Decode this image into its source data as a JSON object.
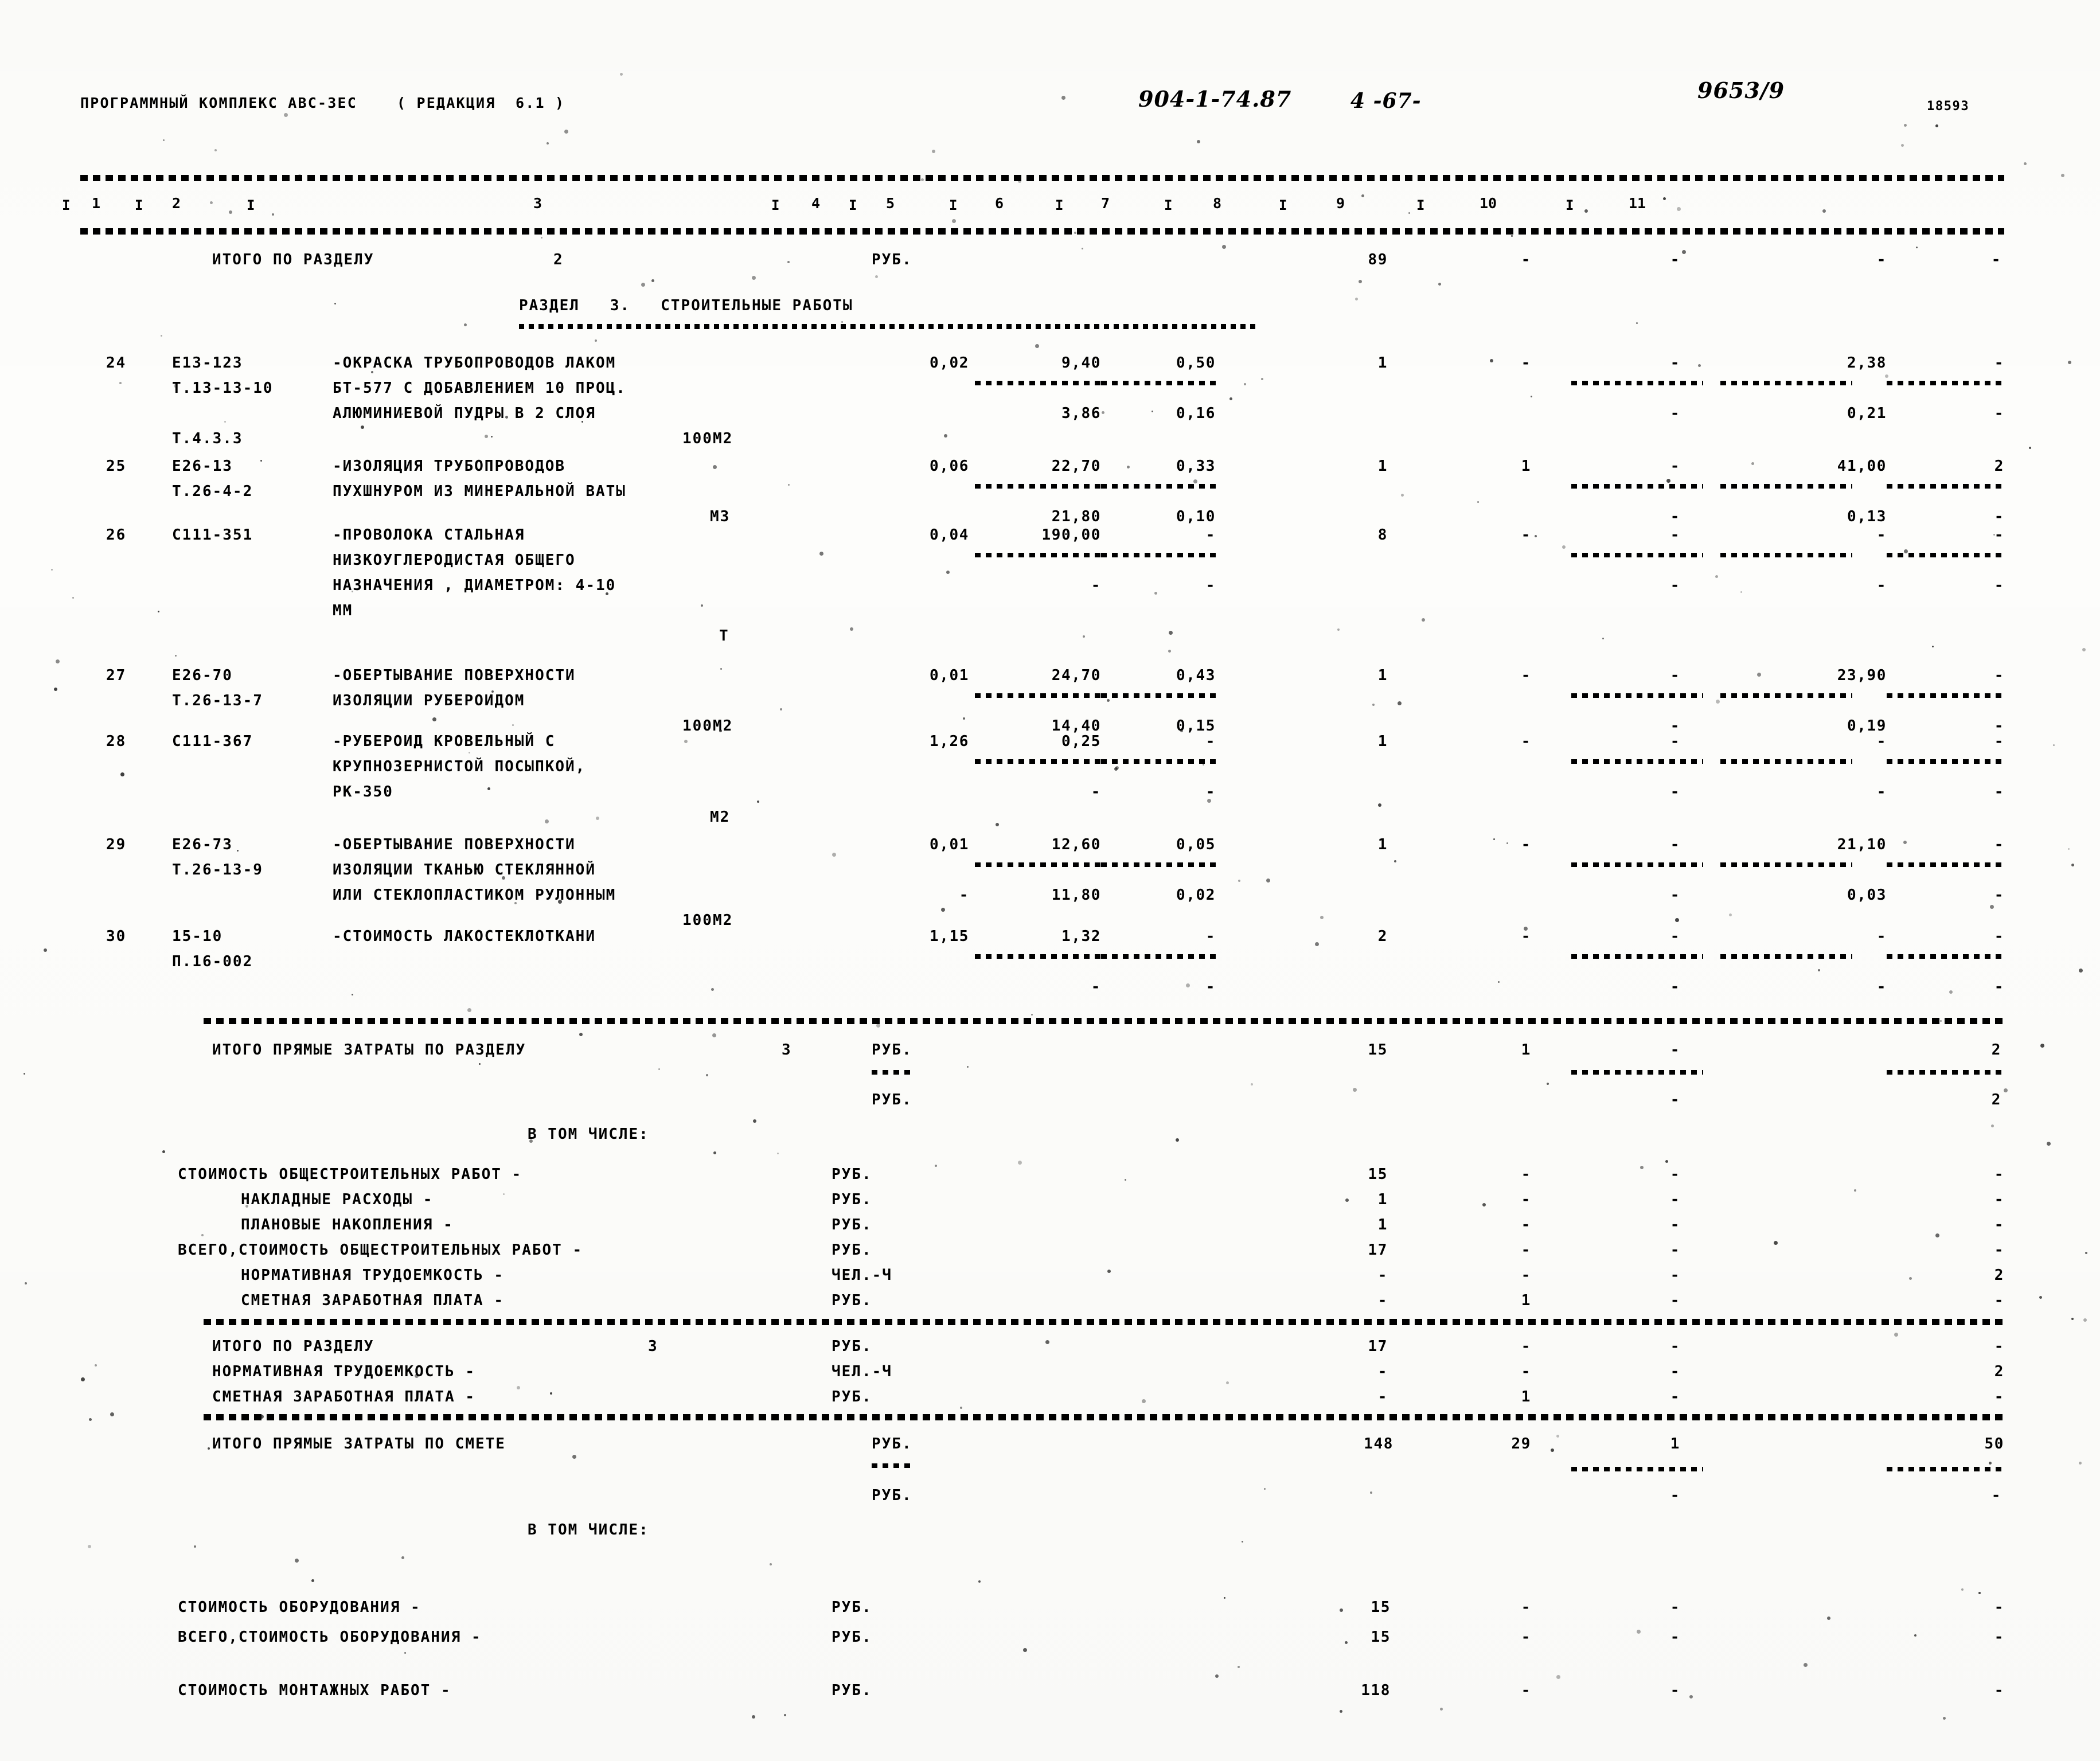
{
  "header": {
    "program_line": "ПРОГРАММНЫЙ КОМПЛЕКС АВС-ЗЕС    ( РЕДАКЦИЯ  6.1 )",
    "hand_code": "904-1-74.87",
    "hand_page": "4 -67-",
    "hand_doc": "9653/9",
    "hand_number": "18593"
  },
  "column_numbers": [
    "1",
    "2",
    "3",
    "4",
    "5",
    "6",
    "7",
    "8",
    "9",
    "10",
    "11"
  ],
  "section": {
    "prev_total_label": "ИТОГО ПО РАЗДЕЛУ",
    "prev_total_num": "2",
    "prev_total_unit": "РУБ.",
    "prev_total_c7": "89",
    "prev_total_c8": "-",
    "prev_total_c9": "-",
    "prev_total_c10": "-",
    "prev_total_c11": "-",
    "title": "РАЗДЕЛ   3.   СТРОИТЕЛЬНЫЕ РАБОТЫ"
  },
  "rows": [
    {
      "no": "24",
      "code": "Е13-123",
      "code2": "Т.13-13-10",
      "code3": "Т.4.3.3",
      "desc": [
        "-ОКРАСКА ТРУБОПРОВОДОВ ЛАКОМ",
        "БТ-577 С ДОБАВЛЕНИЕМ 10 ПРОЦ.",
        "АЛЮМИНИЕВОЙ ПУДРЫ В 2 СЛОЯ"
      ],
      "unit": "100М2",
      "c4": "0,02",
      "c5": "9,40",
      "c6": "0,50",
      "c7": "1",
      "c8": "-",
      "c9": "-",
      "c10": "2,38",
      "c11": "-",
      "sub": {
        "c5": "3,86",
        "c6": "0,16",
        "c9": "-",
        "c10": "0,21",
        "c11": "-"
      }
    },
    {
      "no": "25",
      "code": "Е26-13",
      "code2": "Т.26-4-2",
      "code3": "",
      "desc": [
        "-ИЗОЛЯЦИЯ ТРУБОПРОВОДОВ",
        "ПУХШНУРОМ ИЗ МИНЕРАЛЬНОЙ ВАТЫ"
      ],
      "unit": "М3",
      "c4": "0,06",
      "c5": "22,70",
      "c6": "0,33",
      "c7": "1",
      "c8": "1",
      "c9": "-",
      "c10": "41,00",
      "c11": "2",
      "sub": {
        "c5": "21,80",
        "c6": "0,10",
        "c9": "-",
        "c10": "0,13",
        "c11": "-"
      }
    },
    {
      "no": "26",
      "code": "С111-351",
      "code2": "",
      "code3": "",
      "desc": [
        "-ПРОВОЛОКА СТАЛЬНАЯ",
        "НИЗКОУГЛЕРОДИСТАЯ ОБЩЕГО",
        "НАЗНАЧЕНИЯ , ДИАМЕТРОМ: 4-10",
        "ММ"
      ],
      "unit": "Т",
      "c4": "0,04",
      "c5": "190,00",
      "c6": "-",
      "c7": "8",
      "c8": "-",
      "c9": "-",
      "c10": "-",
      "c11": "-",
      "sub": {
        "c5": "-",
        "c6": "-",
        "c9": "-",
        "c10": "-",
        "c11": "-"
      }
    },
    {
      "no": "27",
      "code": "Е26-70",
      "code2": "Т.26-13-7",
      "code3": "",
      "desc": [
        "-ОБЕРТЫВАНИЕ ПОВЕРХНОСТИ",
        "ИЗОЛЯЦИИ РУБЕРОИДОМ"
      ],
      "unit": "100М2",
      "c4": "0,01",
      "c5": "24,70",
      "c6": "0,43",
      "c7": "1",
      "c8": "-",
      "c9": "-",
      "c10": "23,90",
      "c11": "-",
      "sub": {
        "c5": "14,40",
        "c6": "0,15",
        "c9": "-",
        "c10": "0,19",
        "c11": "-"
      }
    },
    {
      "no": "28",
      "code": "С111-367",
      "code2": "",
      "code3": "",
      "desc": [
        "-РУБЕРОИД КРОВЕЛЬНЫЙ С",
        "КРУПНОЗЕРНИСТОЙ ПОСЫПКОЙ,",
        "РК-350"
      ],
      "unit": "М2",
      "c4": "1,26",
      "c5": "0,25",
      "c6": "-",
      "c7": "1",
      "c8": "-",
      "c9": "-",
      "c10": "-",
      "c11": "-",
      "sub": {
        "c5": "-",
        "c6": "-",
        "c9": "-",
        "c10": "-",
        "c11": "-"
      }
    },
    {
      "no": "29",
      "code": "Е26-73",
      "code2": "Т.26-13-9",
      "code3": "",
      "desc": [
        "-ОБЕРТЫВАНИЕ ПОВЕРХНОСТИ",
        "ИЗОЛЯЦИИ ТКАНЬЮ СТЕКЛЯННОЙ",
        "ИЛИ СТЕКЛОПЛАСТИКОМ РУЛОННЫМ"
      ],
      "unit": "100М2",
      "c4": "0,01",
      "c5": "12,60",
      "c6": "0,05",
      "c7": "1",
      "c8": "-",
      "c9": "-",
      "c10": "21,10",
      "c11": "-",
      "sub": {
        "c4": "-",
        "c5": "11,80",
        "c6": "0,02",
        "c9": "-",
        "c10": "0,03",
        "c11": "-"
      }
    },
    {
      "no": "30",
      "code": "15-10",
      "code2": "П.16-002",
      "code3": "",
      "desc": [
        "-СТОИМОСТЬ ЛАКОСТЕКЛОТКАНИ"
      ],
      "unit": "",
      "c4": "1,15",
      "c5": "1,32",
      "c6": "-",
      "c7": "2",
      "c8": "-",
      "c9": "-",
      "c10": "-",
      "c11": "-",
      "sub": {
        "c5": "-",
        "c6": "-",
        "c9": "-",
        "c10": "-",
        "c11": "-"
      }
    }
  ],
  "totals": {
    "direct_section_label": "ИТОГО ПРЯМЫЕ ЗАТРАТЫ ПО РАЗДЕЛУ",
    "direct_section_num": "3",
    "direct_section_unit": "РУБ.",
    "direct_section_unit2": "РУБ.",
    "direct_section_c7": "15",
    "direct_section_c8": "1",
    "direct_section_c9": "-",
    "direct_section_c11": "2",
    "including_label": "В ТОМ ЧИСЛЕ:",
    "lines": [
      {
        "label": "СТОИМОСТЬ ОБЩЕСТРОИТЕЛЬНЫХ РАБОТ -",
        "unit": "РУБ.",
        "c7": "15",
        "c8": "-",
        "c9": "-",
        "c11": "-",
        "indent": 0
      },
      {
        "label": "НАКЛАДНЫЕ РАСХОДЫ -",
        "unit": "РУБ.",
        "c7": "1",
        "c8": "-",
        "c9": "-",
        "c11": "-",
        "indent": 1
      },
      {
        "label": "ПЛАНОВЫЕ НАКОПЛЕНИЯ -",
        "unit": "РУБ.",
        "c7": "1",
        "c8": "-",
        "c9": "-",
        "c11": "-",
        "indent": 1
      },
      {
        "label": "ВСЕГО,СТОИМОСТЬ ОБЩЕСТРОИТЕЛЬНЫХ РАБОТ -",
        "unit": "РУБ.",
        "c7": "17",
        "c8": "-",
        "c9": "-",
        "c11": "-",
        "indent": 0
      },
      {
        "label": "НОРМАТИВНАЯ ТРУДОЕМКОСТЬ -",
        "unit": "ЧЕЛ.-Ч",
        "c7": "-",
        "c8": "-",
        "c9": "-",
        "c11": "2",
        "indent": 1
      },
      {
        "label": "СМЕТНАЯ ЗАРАБОТНАЯ ПЛАТА -",
        "unit": "РУБ.",
        "c7": "-",
        "c8": "1",
        "c9": "-",
        "c11": "-",
        "indent": 1
      }
    ],
    "section_total_label": "ИТОГО ПО РАЗДЕЛУ",
    "section_total_num": "3",
    "section_total_lines": [
      {
        "label": "ИТОГО ПО РАЗДЕЛУ",
        "num": "3",
        "unit": "РУБ.",
        "c7": "17",
        "c8": "-",
        "c9": "-",
        "c11": "-"
      },
      {
        "label": "НОРМАТИВНАЯ ТРУДОЕМКОСТЬ -",
        "num": "",
        "unit": "ЧЕЛ.-Ч",
        "c7": "-",
        "c8": "-",
        "c9": "-",
        "c11": "2"
      },
      {
        "label": "СМЕТНАЯ ЗАРАБОТНАЯ ПЛАТА -",
        "num": "",
        "unit": "РУБ.",
        "c7": "-",
        "c8": "1",
        "c9": "-",
        "c11": "-"
      }
    ],
    "estimate_direct_label": "ИТОГО ПРЯМЫЕ ЗАТРАТЫ ПО СМЕТЕ",
    "estimate_direct_unit": "РУБ.",
    "estimate_direct_unit2": "РУБ.",
    "estimate_direct_c7": "148",
    "estimate_direct_c8": "29",
    "estimate_direct_c9": "1",
    "estimate_direct_c11": "50",
    "including_label2": "В ТОМ ЧИСЛЕ:",
    "bottom_lines": [
      {
        "label": "СТОИМОСТЬ ОБОРУДОВАНИЯ -",
        "unit": "РУБ.",
        "c7": "15",
        "c8": "-",
        "c9": "-",
        "c11": "-"
      },
      {
        "label": "ВСЕГО,СТОИМОСТЬ ОБОРУДОВАНИЯ -",
        "unit": "РУБ.",
        "c7": "15",
        "c8": "-",
        "c9": "-",
        "c11": "-"
      },
      {
        "label": "СТОИМОСТЬ МОНТАЖНЫХ РАБОТ -",
        "unit": "РУБ.",
        "c7": "118",
        "c8": "-",
        "c9": "-",
        "c11": "-"
      }
    ]
  }
}
